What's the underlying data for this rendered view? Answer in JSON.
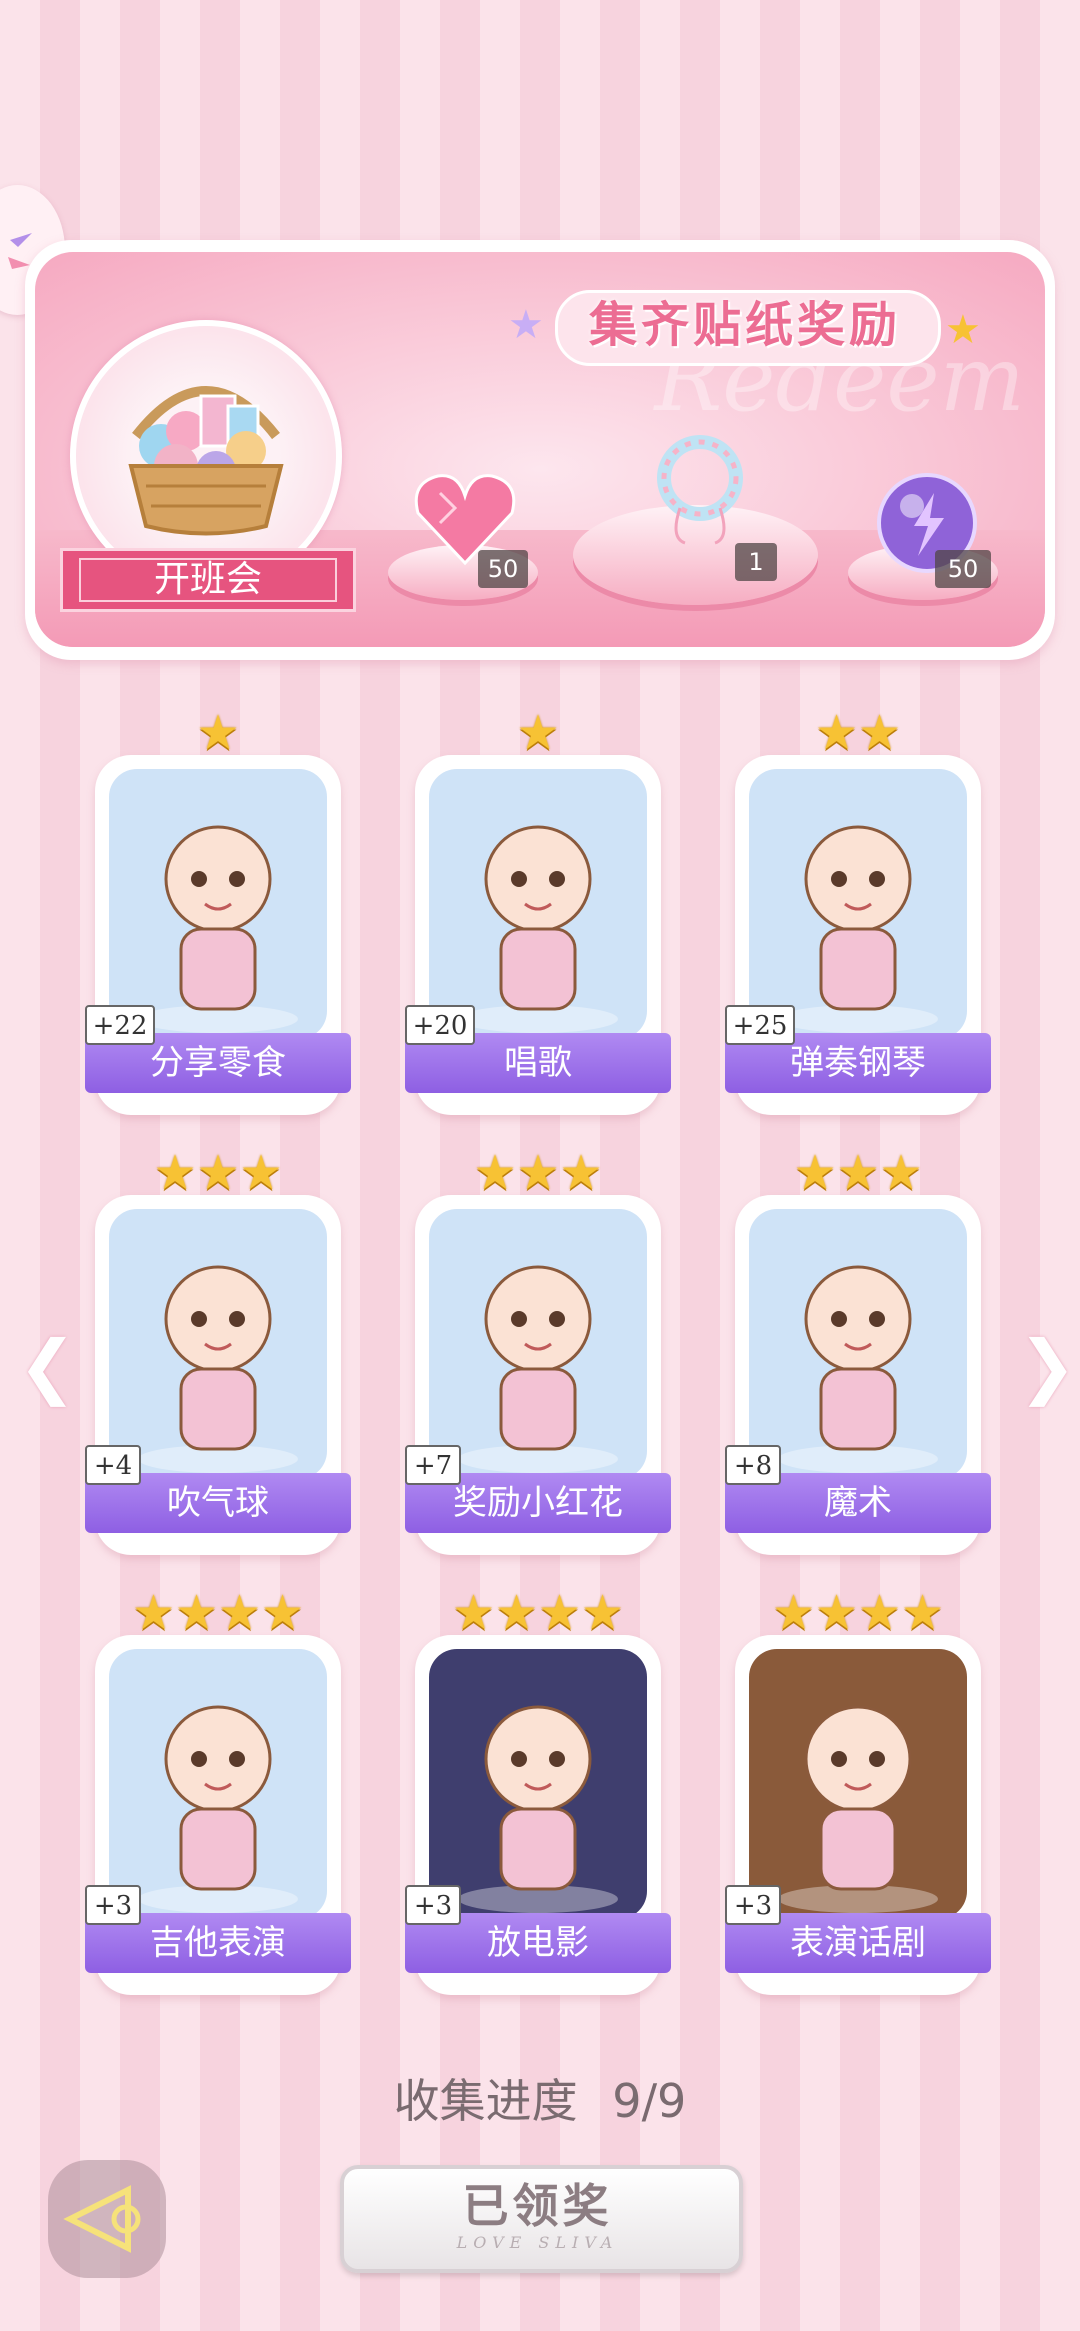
{
  "header": {
    "title": "集齐贴纸奖励",
    "main_reward_label": "开班会",
    "watermark": "Redeem"
  },
  "rewards": [
    {
      "icon": "heart-gem-icon",
      "count": "50"
    },
    {
      "icon": "bead-bracelet-icon",
      "count": "1"
    },
    {
      "icon": "energy-orb-icon",
      "count": "50"
    }
  ],
  "cards": [
    {
      "label": "分享零食",
      "bonus": "+22",
      "stars": "★",
      "image": "snack-basket-image"
    },
    {
      "label": "唱歌",
      "bonus": "+20",
      "stars": "★",
      "image": "singing-peacock-image"
    },
    {
      "label": "弹奏钢琴",
      "bonus": "+25",
      "stars": "★★",
      "image": "piano-boy-image"
    },
    {
      "label": "吹气球",
      "bonus": "+4",
      "stars": "★★★",
      "image": "balloon-boy-image"
    },
    {
      "label": "奖励小红花",
      "bonus": "+7",
      "stars": "★★★",
      "image": "bunny-flower-image"
    },
    {
      "label": "魔术",
      "bonus": "+8",
      "stars": "★★★",
      "image": "magician-girl-image"
    },
    {
      "label": "吉他表演",
      "bonus": "+3",
      "stars": "★★★★",
      "image": "guitar-wolf-image"
    },
    {
      "label": "放电影",
      "bonus": "+3",
      "stars": "★★★★",
      "image": "movie-girl-image"
    },
    {
      "label": "表演话剧",
      "bonus": "+3",
      "stars": "★★★★",
      "image": "drama-cat-girl-image"
    }
  ],
  "progress": {
    "label": "收集进度",
    "value": "9/9"
  },
  "claim_button": {
    "label": "已领奖",
    "sub": "LOVE SLIVA"
  },
  "colors": {
    "accent_pink": "#e6547f",
    "card_label_purple": "#9a6be8",
    "star_gold": "#f7c234"
  }
}
